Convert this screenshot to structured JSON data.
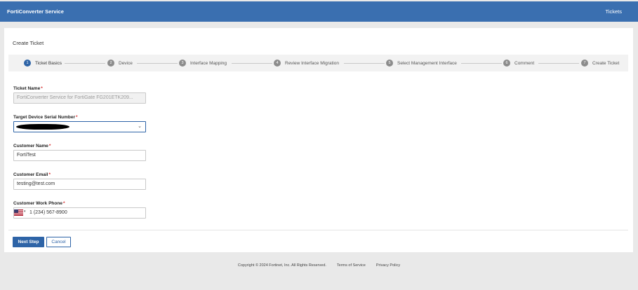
{
  "header": {
    "brand": "FortiConverter Service",
    "nav_tickets": "Tickets"
  },
  "page": {
    "title": "Create Ticket"
  },
  "stepper": {
    "steps": [
      {
        "num": "1",
        "label": "Ticket Basics"
      },
      {
        "num": "2",
        "label": "Device"
      },
      {
        "num": "3",
        "label": "Interface Mapping"
      },
      {
        "num": "4",
        "label": "Review Interface Migration"
      },
      {
        "num": "5",
        "label": "Select Management Interface"
      },
      {
        "num": "6",
        "label": "Comment"
      },
      {
        "num": "7",
        "label": "Create Ticket"
      }
    ],
    "active_step": 1
  },
  "form": {
    "ticket_name": {
      "label": "Ticket Name",
      "value": "FortiConverter Service for FortiGate FG201ETK209..."
    },
    "serial_number": {
      "label": "Target Device Serial Number",
      "value": ""
    },
    "customer_name": {
      "label": "Customer Name",
      "value": "FortiTest"
    },
    "customer_email": {
      "label": "Customer Email",
      "value": "testing@test.com"
    },
    "customer_phone": {
      "label": "Customer Work Phone",
      "value": "1 (234) 567-8900"
    },
    "required_mark": "*"
  },
  "actions": {
    "next_label": "Next Step",
    "cancel_label": "Cancel"
  },
  "footer": {
    "copyright": "Copyright © 2024 Fortinet, Inc. All Rights Reserved.",
    "terms": "Terms of Service",
    "privacy": "Privacy Policy"
  },
  "colors": {
    "brand_blue": "#3a6fb0",
    "active_step": "#2e64a7",
    "required": "#d62b2b"
  }
}
